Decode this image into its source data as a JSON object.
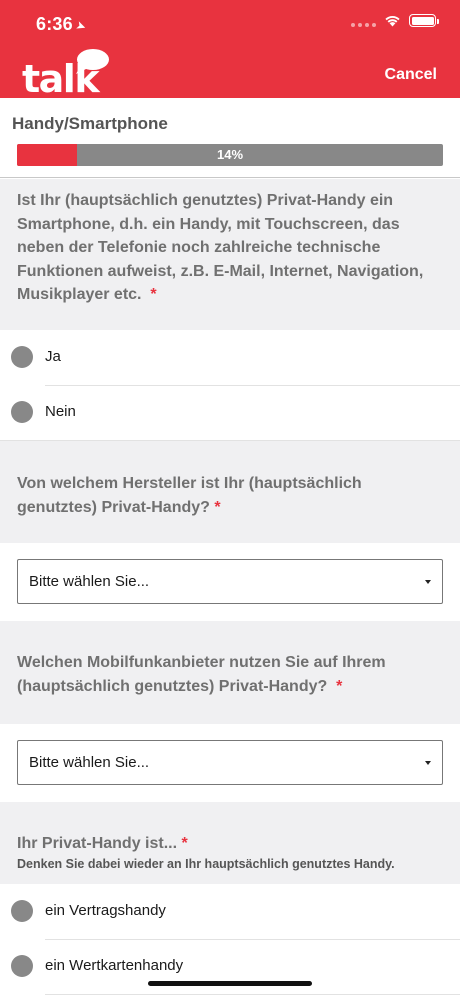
{
  "status_bar": {
    "time": "6:36"
  },
  "header": {
    "logo_text": "talk",
    "cancel_label": "Cancel"
  },
  "survey": {
    "title": "Handy/Smartphone",
    "progress_label": "14%",
    "progress_fraction": 0.14
  },
  "questions": [
    {
      "text": "Ist Ihr (hauptsächlich genutztes) Privat-Handy ein Smartphone, d.h. ein Handy, mit Touchscreen, das neben der Telefonie noch zahlreiche technische Funktionen aufweist, z.B. E-Mail, Internet, Navigation, Musikplayer etc.",
      "required_mark": "*",
      "options": [
        "Ja",
        "Nein"
      ]
    },
    {
      "text": "Von welchem Hersteller ist Ihr (hauptsächlich genutztes) Privat-Handy?",
      "required_mark": "*",
      "select_value": "Bitte wählen Sie..."
    },
    {
      "text": "Welchen Mobilfunkanbieter nutzen Sie auf Ihrem (hauptsächlich genutztes) Privat-Handy?",
      "required_mark": "*",
      "select_value": "Bitte wählen Sie..."
    },
    {
      "text": "Ihr Privat-Handy ist...",
      "required_mark": "*",
      "subtext": "Denken Sie dabei wieder an Ihr hauptsächlich genutztes Handy.",
      "options": [
        "ein Vertragshandy",
        "ein Wertkartenhandy"
      ]
    }
  ],
  "colors": {
    "brand": "#e8333f",
    "progress_track": "#888888",
    "question_bg": "#f0f0f2",
    "question_text": "#707070"
  },
  "icons": [
    "location-arrow-icon",
    "cellular-signal-icon",
    "wifi-icon",
    "battery-icon",
    "speech-bubble-logo-icon",
    "dropdown-caret-icon"
  ]
}
